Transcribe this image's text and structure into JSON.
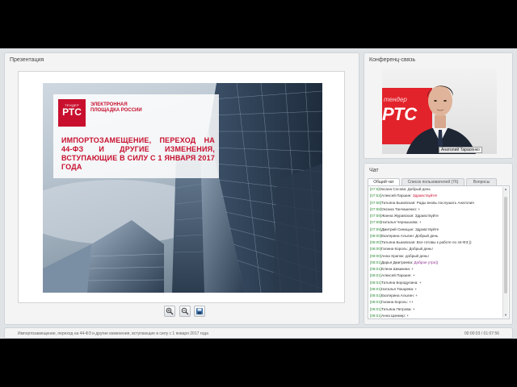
{
  "presentation": {
    "title": "Презентация",
    "slide": {
      "logo_small": "ТЕНДЕР",
      "logo_big": "РТС",
      "brand": "ЭЛЕКТРОННАЯ ПЛОЩАДКА РОССИИ",
      "headline": "ИМПОРТОЗАМЕЩЕНИЕ, ПЕРЕХОД НА 44-ФЗ И ДРУГИЕ ИЗМЕНЕНИЯ, ВСТУПАЮЩИЕ В СИЛУ С 1 ЯНВАРЯ 2017 ГОДА"
    },
    "toolbar": [
      "zoom-in-icon",
      "zoom-out-icon",
      "save-icon"
    ]
  },
  "conference": {
    "title": "Конференц-связь",
    "video_caption": "Анатолий Тарасенко",
    "background_small": "тендер",
    "background_big": "РТС"
  },
  "chat": {
    "title": "Чат",
    "tabs": [
      "Общий чат",
      "Список пользователей (76)",
      "Вопросы"
    ],
    "messages": [
      {
        "time": "[07:5]",
        "name": "Оксана Сосова:",
        "text": " Добрый день",
        "style": "normal"
      },
      {
        "time": "[07:53]",
        "name": "Алексей Паршин:",
        "text": " Здравствуйте!",
        "style": "red"
      },
      {
        "time": "[07:58]",
        "name": "Татьяна Быковская:",
        "text": " Рады вновь послушать Анатолия",
        "style": "normal"
      },
      {
        "time": "[07:58]",
        "name": "Оксана Танчашенко:",
        "text": " +",
        "style": "normal"
      },
      {
        "time": "[07:59]",
        "name": "Жанна Журавская:",
        "text": " Здравствуйте",
        "style": "normal"
      },
      {
        "time": "[07:59]",
        "name": "Наталья Чернышова:",
        "text": " +",
        "style": "normal"
      },
      {
        "time": "[07:59]",
        "name": "Дмитрий Синицын:",
        "text": " Здравствуйте",
        "style": "normal"
      },
      {
        "time": "[08:00]",
        "name": "Екатерина Алыгин:",
        "text": " Добрый день",
        "style": "normal"
      },
      {
        "time": "[08:00]",
        "name": "Татьяна Быковская:",
        "text": " Все готовы к работе по 44-ФЗ:))",
        "style": "normal"
      },
      {
        "time": "[08:00]",
        "name": "Галина Король:",
        "text": " Добрый день!",
        "style": "normal"
      },
      {
        "time": "[08:00]",
        "name": "Анна Храпок:",
        "text": " добрый день!",
        "style": "normal"
      },
      {
        "time": "[08:01]",
        "name": "Дарья Дмитриева:",
        "text": " Доброе утро))",
        "style": "purple"
      },
      {
        "time": "[08:01]",
        "name": "Елена Шишкина:",
        "text": " +",
        "style": "normal"
      },
      {
        "time": "[08:01]",
        "name": "Алексей Паршин:",
        "text": " +",
        "style": "normal"
      },
      {
        "time": "[08:01]",
        "name": "Татьяна Бородулина:",
        "text": " +",
        "style": "normal"
      },
      {
        "time": "[08:01]",
        "name": "Наталья Токарева:",
        "text": " +",
        "style": "normal"
      },
      {
        "time": "[08:01]",
        "name": "Екатерина Алыгин:",
        "text": " +",
        "style": "normal"
      },
      {
        "time": "[08:01]",
        "name": "Галина Король:",
        "text": " ++",
        "style": "normal"
      },
      {
        "time": "[08:01]",
        "name": "Татьяна Петрова:",
        "text": " +",
        "style": "normal"
      },
      {
        "time": "[08:01]",
        "name": "Анна Цинмер:",
        "text": " +",
        "style": "normal"
      }
    ]
  },
  "bottom_bar": {
    "title": "Импортозамещение, переход на 44-ФЗ и другие изменения, вступающие в силу с 1 января 2017 года",
    "time": "00:00:03 / 01:07:56"
  }
}
